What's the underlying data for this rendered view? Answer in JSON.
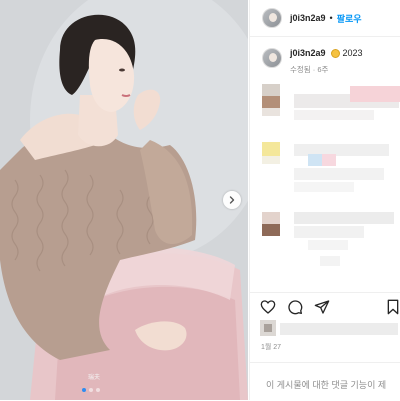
{
  "post": {
    "username": "j0i3n2a9",
    "dot": "•",
    "follow_label": "팔로우",
    "caption_year": "2023",
    "edited_meta": "수정됨 · 6주",
    "date": "1월 27",
    "comments_disabled": "이 게시물에 대한 댓글 기능이 제"
  },
  "photo": {
    "watermark": "瑞夫",
    "carousel_dots": 3,
    "active_dot": 0
  },
  "icons": {
    "next": "chevron-right-icon",
    "like": "heart-icon",
    "comment": "comment-icon",
    "share": "paper-plane-icon",
    "save": "bookmark-icon",
    "badge": "emoji-icon"
  },
  "colors": {
    "accent": "#0095f6",
    "dot_active": "#2f8cf0",
    "muted": "#8e8e8e",
    "text": "#262626"
  }
}
